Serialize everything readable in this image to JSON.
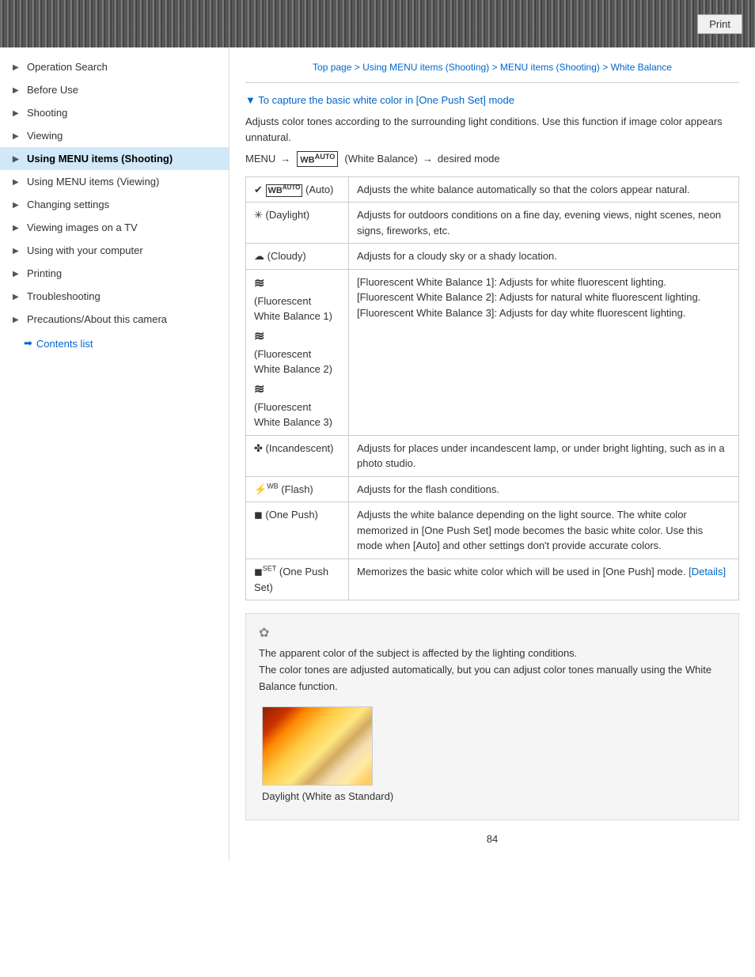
{
  "header": {
    "print_label": "Print"
  },
  "breadcrumb": {
    "top": "Top page",
    "sep1": " > ",
    "level1": "Using MENU items (Shooting)",
    "sep2": " > ",
    "level2": "MENU items (Shooting)",
    "sep3": " > ",
    "level3": "White Balance"
  },
  "sidebar": {
    "items": [
      {
        "label": "Operation Search",
        "active": false
      },
      {
        "label": "Before Use",
        "active": false
      },
      {
        "label": "Shooting",
        "active": false
      },
      {
        "label": "Viewing",
        "active": false
      },
      {
        "label": "Using MENU items (Shooting)",
        "active": true
      },
      {
        "label": "Using MENU items (Viewing)",
        "active": false
      },
      {
        "label": "Changing settings",
        "active": false
      },
      {
        "label": "Viewing images on a TV",
        "active": false
      },
      {
        "label": "Using with your computer",
        "active": false
      },
      {
        "label": "Printing",
        "active": false
      },
      {
        "label": "Troubleshooting",
        "active": false
      },
      {
        "label": "Precautions/About this camera",
        "active": false
      }
    ],
    "contents_list": "Contents list"
  },
  "content": {
    "section_heading": "▼ To capture the basic white color in [One Push Set] mode",
    "intro": "Adjusts color tones according to the surrounding light conditions. Use this function if image color appears unnatural.",
    "menu_path": {
      "start": "MENU",
      "arrow1": "→",
      "wb_label": "WB AUTO",
      "wb_desc": "(White Balance)",
      "arrow2": "→",
      "end": "desired mode"
    },
    "table": {
      "rows": [
        {
          "icon": "✔ WB AUTO",
          "label": "(Auto)",
          "description": "Adjusts the white balance automatically so that the colors appear natural."
        },
        {
          "icon": "✳",
          "label": "(Daylight)",
          "description": "Adjusts for outdoors conditions on a fine day, evening views, night scenes, neon signs, fireworks, etc."
        },
        {
          "icon": "☁",
          "label": "(Cloudy)",
          "description": "Adjusts for a cloudy sky or a shady location."
        },
        {
          "icon": "≋",
          "label": "(Fluorescent White Balance 1)\n≋\n(Fluorescent White Balance 2)\n≋\n(Fluorescent White Balance 3)",
          "description": "[Fluorescent White Balance 1]: Adjusts for white fluorescent lighting.\n[Fluorescent White Balance 2]: Adjusts for natural white fluorescent lighting.\n[Fluorescent White Balance 3]: Adjusts for day white fluorescent lighting."
        },
        {
          "icon": "❊",
          "label": "(Incandescent)",
          "description": "Adjusts for places under incandescent lamp, or under bright lighting, such as in a photo studio."
        },
        {
          "icon": "⚡WB",
          "label": "(Flash)",
          "description": "Adjusts for the flash conditions."
        },
        {
          "icon": "◼",
          "label": "(One Push)",
          "description": "Adjusts the white balance depending on the light source. The white color memorized in [One Push Set] mode becomes the basic white color. Use this mode when [Auto] and other settings don't provide accurate colors."
        },
        {
          "icon": "◼SET",
          "label": "(One Push Set)",
          "description": "Memorizes the basic white color which will be used in [One Push] mode.",
          "details_link": "[Details]"
        }
      ]
    },
    "tip": {
      "icon": "✿",
      "lines": [
        "The apparent color of the subject is affected by the lighting conditions.",
        "The color tones are adjusted automatically, but you can adjust color tones manually using the White Balance function."
      ]
    },
    "image_caption": "Daylight (White as Standard)",
    "page_number": "84"
  }
}
